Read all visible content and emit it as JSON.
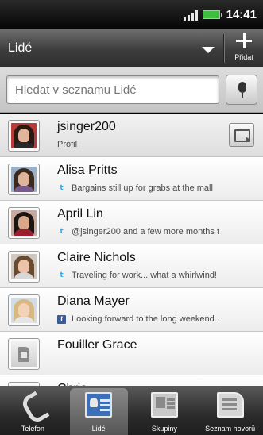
{
  "status_bar": {
    "time": "14:41"
  },
  "title_bar": {
    "title": "Lidé",
    "add_label": "Přidat"
  },
  "search": {
    "placeholder": "Hledat v seznamu Lidé"
  },
  "profile": {
    "name": "jsinger200",
    "subtitle": "Profil"
  },
  "contacts": [
    {
      "name": "Alisa Pritts",
      "source_icon": "twitter-icon",
      "status": "Bargains still up for grabs at the mall",
      "avatar": {
        "hair": "#3a2a20",
        "face": "#e0b59a",
        "shirt": "#7a5a8a",
        "bg": "#9ab0c8"
      }
    },
    {
      "name": "April Lin",
      "source_icon": "twitter-icon",
      "status": "@jsinger200 and a few more months t",
      "avatar": {
        "hair": "#1a1412",
        "face": "#d9a88a",
        "shirt": "#9a1e2e",
        "bg": "#c9a8a0"
      }
    },
    {
      "name": "Claire Nichols",
      "source_icon": "twitter-icon",
      "status": "Traveling for work... what a whirlwind!",
      "avatar": {
        "hair": "#6a4a2e",
        "face": "#ecc3a8",
        "shirt": "#d8d8d8",
        "bg": "#cfc8c0"
      }
    },
    {
      "name": "Diana Mayer",
      "source_icon": "facebook-icon",
      "status": "Looking forward to the long weekend..",
      "avatar": {
        "hair": "#d8b880",
        "face": "#f2d2b8",
        "shirt": "#e6e6e6",
        "bg": "#d0dce6"
      }
    },
    {
      "name": "Fouiller Grace",
      "source_icon": "sim-card-icon",
      "status": ""
    },
    {
      "name": "Chris",
      "source_icon": "sim-card-icon",
      "status": ""
    }
  ],
  "bottom_tabs": [
    {
      "label": "Telefon",
      "icon": "phone-icon",
      "active": false
    },
    {
      "label": "Lidé",
      "icon": "people-icon",
      "active": true
    },
    {
      "label": "Skupiny",
      "icon": "groups-icon",
      "active": false
    },
    {
      "label": "Seznam hovorů",
      "icon": "call-history-icon",
      "active": false
    }
  ],
  "colors": {
    "twitter": "#33aaee",
    "facebook": "#3b5a98",
    "battery": "#3fbf3f"
  }
}
